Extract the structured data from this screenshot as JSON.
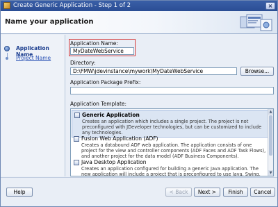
{
  "window": {
    "title": "Create Generic Application - Step 1 of 2",
    "close_glyph": "×"
  },
  "header": {
    "page_title": "Name your application",
    "graphic_icon": "wizard-graphic-icon"
  },
  "nav": {
    "items": [
      {
        "label": "Application Name",
        "active": true
      },
      {
        "label": "Project Name",
        "active": false
      }
    ]
  },
  "form": {
    "app_name_label": "Application Name:",
    "app_name_value": "MyDateWebService",
    "directory_label": "Directory:",
    "directory_value": "D:\\FMW\\jdevinstance\\mywork\\MyDateWebService",
    "browse_label": "Browse...",
    "package_prefix_label": "Application Package Prefix:",
    "package_prefix_value": "",
    "template_label": "Application Template:",
    "templates": [
      {
        "name": "Generic Application",
        "description": "Creates an application which includes a single project. The project is not preconfigured with JDeveloper technologies, but can be customized to include any technologies.",
        "selected": true
      },
      {
        "name": "Fusion Web Application (ADF)",
        "description": "Creates a databound ADF web application. The application consists of one project for the view and controller components (ADF Faces and ADF Task Flows), and another project for the data model (ADF Business Components).",
        "selected": false
      },
      {
        "name": "Java Desktop Application",
        "description": "Creates an application configured for building a generic Java application. The new application will include a project that is preconfigured to use Java, Swing, and JavaBeans technologies.",
        "selected": false
      }
    ]
  },
  "footer": {
    "help_label": "Help",
    "back_label": "< Back",
    "next_label": "Next >",
    "finish_label": "Finish",
    "cancel_label": "Cancel"
  },
  "colors": {
    "title_bar": "#2a4d94",
    "highlight_box": "#d43a3a",
    "nav_link": "#2a52b5"
  }
}
